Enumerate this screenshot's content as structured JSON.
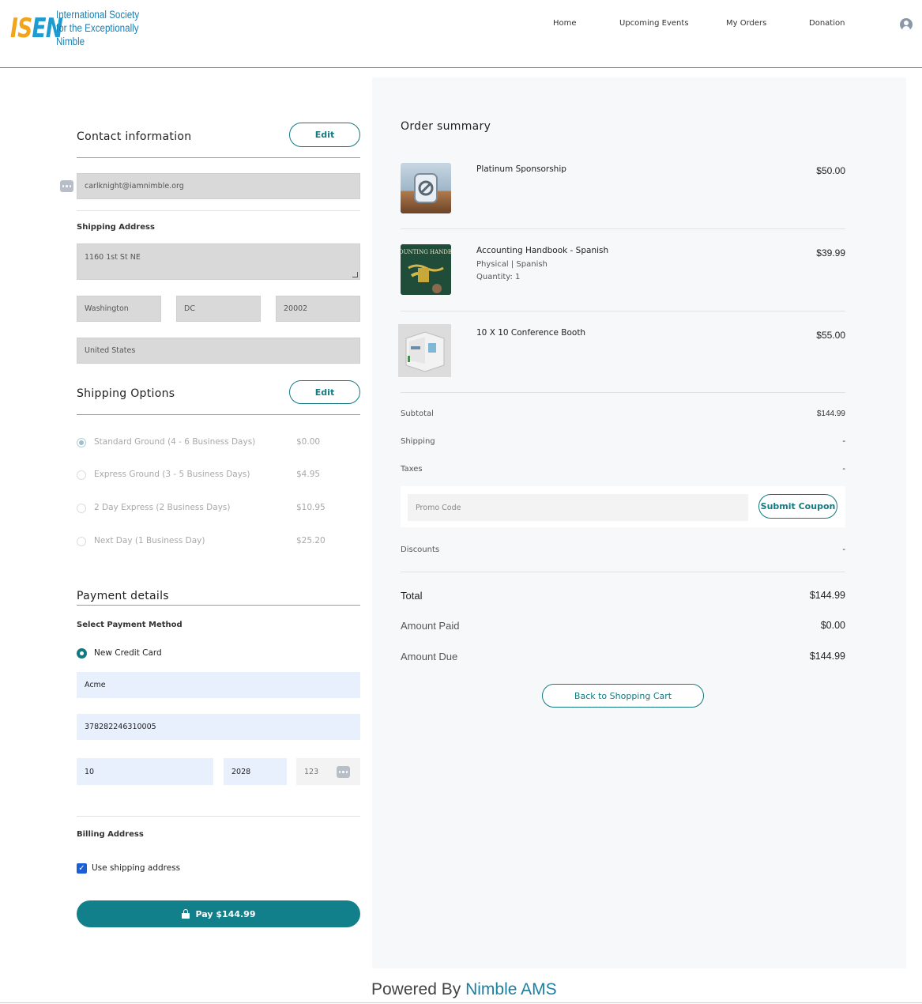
{
  "header": {
    "logo_mark_1": "IS",
    "logo_mark_2": "EN",
    "logo_line1": "International Society",
    "logo_line2": "for the Exceptionally Nimble",
    "nav": [
      "Home",
      "Upcoming Events",
      "My Orders",
      "Donation"
    ],
    "user_icon": "user-circle-icon"
  },
  "contact": {
    "title": "Contact information",
    "edit_label": "Edit",
    "email": "carlknight@iamnimble.org",
    "email_icon": "more-dots-icon"
  },
  "shipping_address": {
    "label": "Shipping Address",
    "street": "1160 1st St NE",
    "city": "Washington",
    "state": "DC",
    "zip": "20002",
    "country": "United States"
  },
  "shipping_options": {
    "title": "Shipping Options",
    "edit_label": "Edit",
    "options": [
      {
        "name": "Standard Ground (4 - 6 Business Days)",
        "price": "$0.00",
        "selected": true
      },
      {
        "name": "Express Ground (3 - 5 Business Days)",
        "price": "$4.95",
        "selected": false
      },
      {
        "name": "2 Day Express (2 Business Days)",
        "price": "$10.95",
        "selected": false
      },
      {
        "name": "Next Day (1 Business Day)",
        "price": "$25.20",
        "selected": false
      }
    ]
  },
  "payment": {
    "title": "Payment details",
    "method_label": "Select Payment Method",
    "method_option": "New Credit Card",
    "card_name": "Acme",
    "card_number": "378282246310005",
    "exp_month": "10",
    "exp_year": "2028",
    "cvv_placeholder": "123",
    "cvv_icon": "more-dots-icon",
    "billing_label": "Billing Address",
    "use_shipping_label": "Use shipping address",
    "use_shipping_checked": true,
    "pay_label": "Pay $144.99",
    "pay_icon": "lock-icon"
  },
  "order_summary": {
    "title": "Order summary",
    "items": [
      {
        "name": "Platinum Sponsorship",
        "details": [],
        "price": "$50.00",
        "thumb": "sponsorship-image"
      },
      {
        "name": "Accounting Handbook - Spanish",
        "details": [
          "Physical | Spanish",
          "Quantity: 1"
        ],
        "price": "$39.99",
        "thumb": "book-cover-image",
        "thumb_text": "ACCOUNTING HANDBOOK"
      },
      {
        "name": "10 X 10 Conference Booth",
        "details": [],
        "price": "$55.00",
        "thumb": "booth-image"
      }
    ],
    "subtotal_label": "Subtotal",
    "subtotal": "$144.99",
    "shipping_label": "Shipping",
    "shipping": "-",
    "taxes_label": "Taxes",
    "taxes": "-",
    "promo_placeholder": "Promo Code",
    "coupon_button": "Submit Coupon",
    "discounts_label": "Discounts",
    "discounts": "-",
    "total_label": "Total",
    "total": "$144.99",
    "amount_paid_label": "Amount Paid",
    "amount_paid": "$0.00",
    "amount_due_label": "Amount Due",
    "amount_due": "$144.99",
    "back_button": "Back to Shopping Cart"
  },
  "footer": {
    "prefix": "Powered By",
    "brand": "Nimble AMS"
  },
  "colors": {
    "accent": "#12808b",
    "logo_orange": "#f2a51a",
    "logo_blue": "#1e9bd0",
    "panel_bg": "#f7f8fa",
    "field_grey": "#d9d9d9",
    "autofill_blue": "#e8f0fe"
  }
}
